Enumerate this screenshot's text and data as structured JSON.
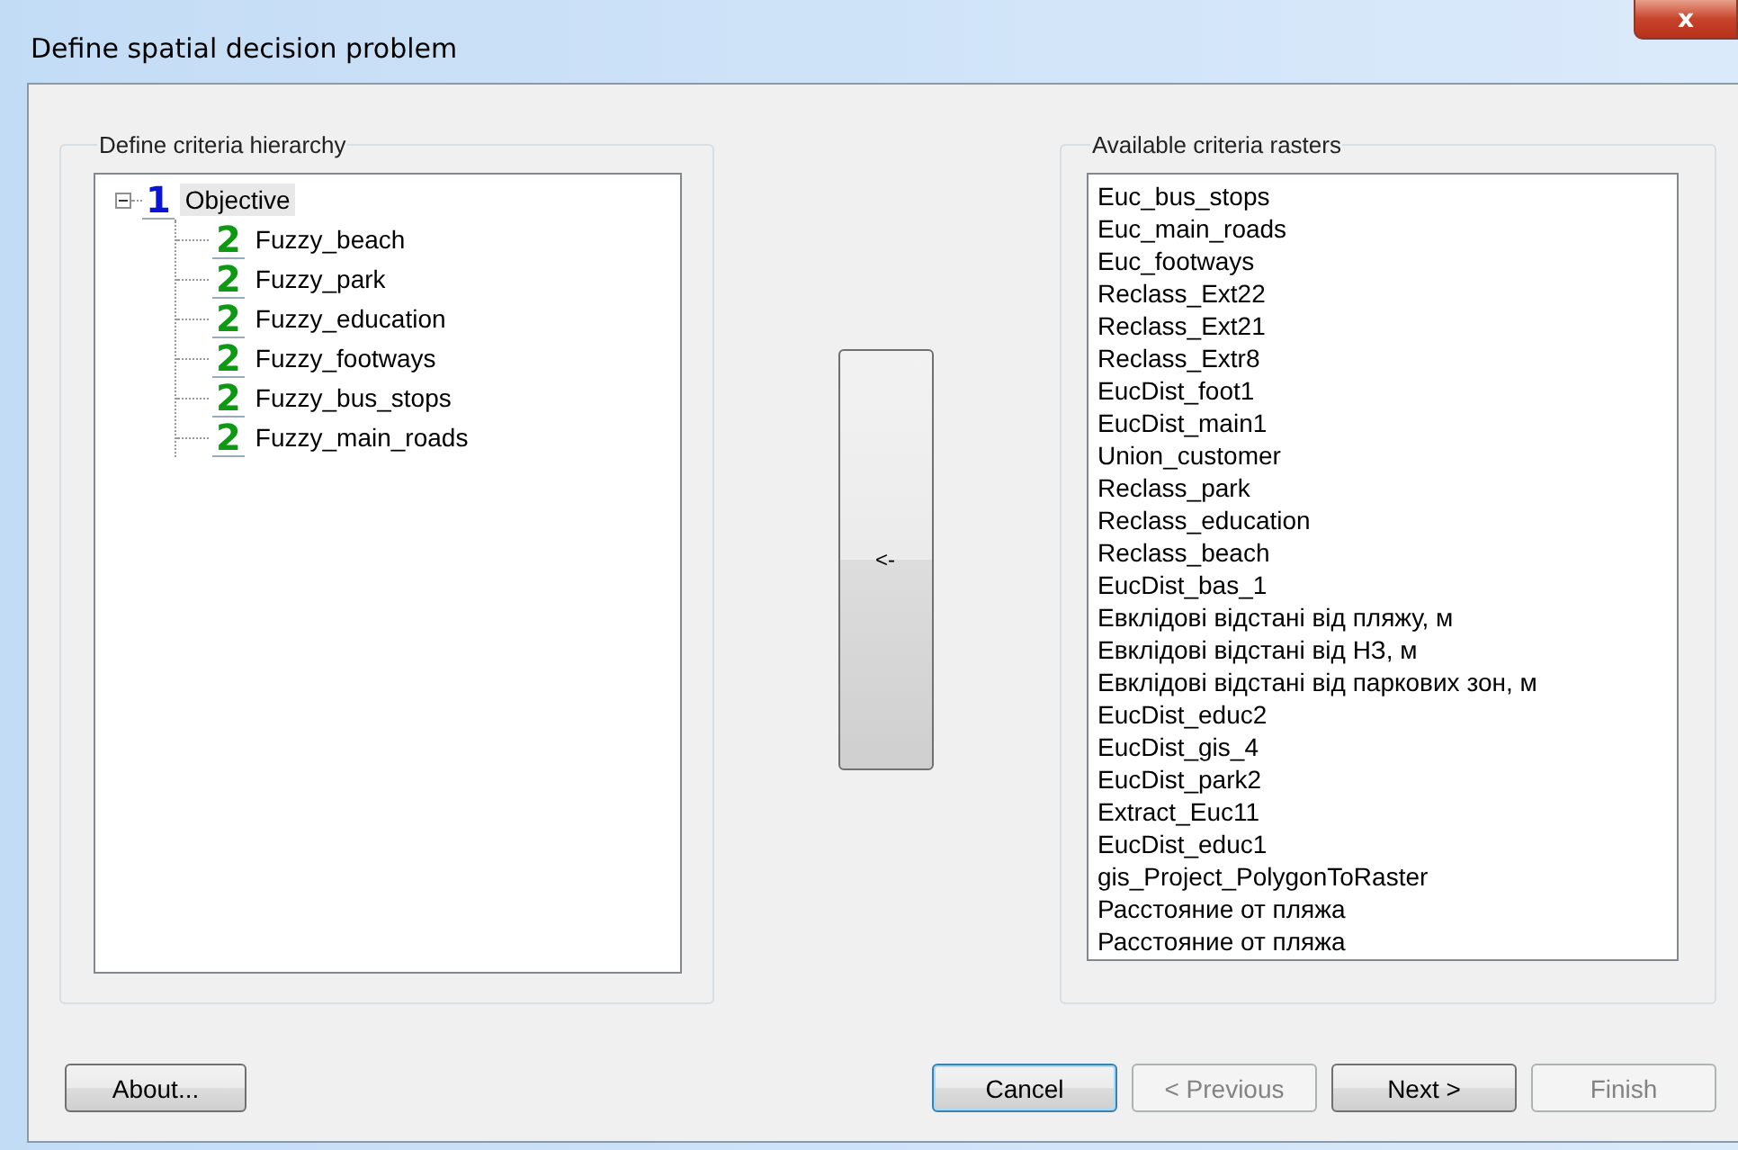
{
  "window": {
    "title": "Define spatial decision problem",
    "close": "x"
  },
  "hierarchy": {
    "label": "Define criteria hierarchy",
    "tree": [
      {
        "badge": "1",
        "label": "Objective",
        "selected": true,
        "expanded": true,
        "children": [
          {
            "badge": "2",
            "label": "Fuzzy_beach",
            "selected": false
          },
          {
            "badge": "2",
            "label": "Fuzzy_park",
            "selected": false
          },
          {
            "badge": "2",
            "label": "Fuzzy_education",
            "selected": false
          },
          {
            "badge": "2",
            "label": "Fuzzy_footways",
            "selected": false
          },
          {
            "badge": "2",
            "label": "Fuzzy_bus_stops",
            "selected": false
          },
          {
            "badge": "2",
            "label": "Fuzzy_main_roads",
            "selected": false
          }
        ]
      }
    ]
  },
  "move_button": "<-",
  "rasters": {
    "label": "Available criteria rasters",
    "items": [
      "Euc_bus_stops",
      "Euc_main_roads",
      "Euc_footways",
      "Reclass_Ext22",
      "Reclass_Ext21",
      "Reclass_Extr8",
      "EucDist_foot1",
      "EucDist_main1",
      "Union_customer",
      "Reclass_park",
      "Reclass_education",
      "Reclass_beach",
      "EucDist_bas_1",
      "Евклідові відстані від пляжу, м",
      "Евклідові відстані від НЗ, м",
      "Евклідові відстані від паркових зон, м",
      "EucDist_educ2",
      "EucDist_gis_4",
      "EucDist_park2",
      "Extract_Euc11",
      "EucDist_educ1",
      "gis_Project_PolygonToRaster",
      "Расстояние от пляжа",
      "Расстояние от пляжа"
    ]
  },
  "buttons": [
    {
      "label": "About...",
      "disabled": false,
      "focused": false
    },
    {
      "label": "Cancel",
      "disabled": false,
      "focused": true
    },
    {
      "label": "< Previous",
      "disabled": true,
      "focused": false
    },
    {
      "label": "Next >",
      "disabled": false,
      "focused": false
    },
    {
      "label": "Finish",
      "disabled": true,
      "focused": false
    }
  ]
}
